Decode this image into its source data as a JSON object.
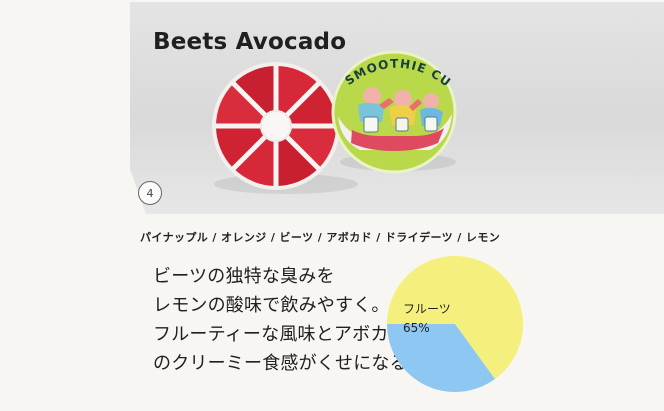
{
  "product": {
    "title": "Beets Avocado",
    "step_number": "4",
    "ingredients": "パイナップル / オレンジ / ビーツ / アボカド / ドライデーツ / レモン",
    "package_text": "SMOOTHIE CUBE",
    "description_lines": [
      "ビーツの独特な臭みを",
      "レモンの酸味で飲みやすく。",
      "フルーティーな風味とアボカド",
      "のクリーミー食感がくせになる。"
    ]
  },
  "chart_data": {
    "type": "pie",
    "slices": [
      {
        "label": "フルーツ",
        "percent_label": "65%",
        "value": 65,
        "color": "#f5f07d"
      },
      {
        "label": "",
        "value": 35,
        "color": "#8ec8f2"
      }
    ]
  },
  "colors": {
    "background": "#f7f6f3",
    "photo_panel": "#dcdcdc",
    "package_lid": "#b9d84a",
    "beet_red": "#d62839",
    "tray_white": "#f6f2f0"
  },
  "icons": {
    "step_badge": "circle-number-icon",
    "product_image": "smoothie-cube-tray-icon"
  }
}
